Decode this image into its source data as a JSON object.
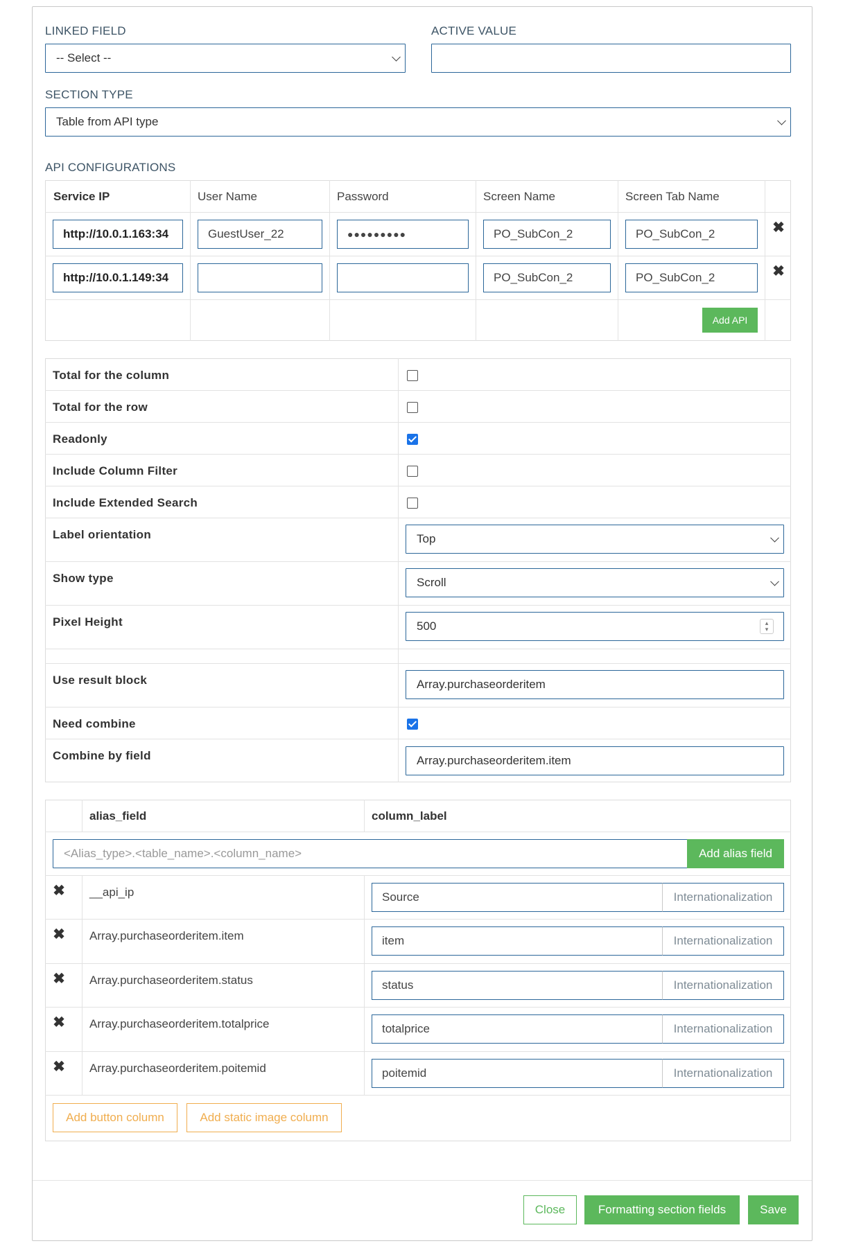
{
  "header": {
    "linked_field_label": "LINKED FIELD",
    "linked_field_value": "-- Select --",
    "active_value_label": "ACTIVE VALUE",
    "active_value_value": "",
    "section_type_label": "SECTION TYPE",
    "section_type_value": "Table from API type"
  },
  "api": {
    "title": "API CONFIGURATIONS",
    "columns": [
      "Service IP",
      "User Name",
      "Password",
      "Screen Name",
      "Screen Tab Name"
    ],
    "rows": [
      {
        "service_ip": "http://10.0.1.163:34",
        "user_name": "GuestUser_22",
        "password": "●●●●●●●●●",
        "screen_name": "PO_SubCon_2",
        "screen_tab_name": "PO_SubCon_2"
      },
      {
        "service_ip": "http://10.0.1.149:34",
        "user_name": "",
        "password": "",
        "screen_name": "PO_SubCon_2",
        "screen_tab_name": "PO_SubCon_2"
      }
    ],
    "remove_icon": "times-icon",
    "add_api_label": "Add API"
  },
  "props": {
    "total_column_label": "Total for the column",
    "total_column_checked": false,
    "total_row_label": "Total for the row",
    "total_row_checked": false,
    "readonly_label": "Readonly",
    "readonly_checked": true,
    "column_filter_label": "Include Column Filter",
    "column_filter_checked": false,
    "extended_search_label": "Include Extended Search",
    "extended_search_checked": false,
    "label_orientation_label": "Label orientation",
    "label_orientation_value": "Top",
    "show_type_label": "Show type",
    "show_type_value": "Scroll",
    "pixel_height_label": "Pixel Height",
    "pixel_height_value": "500",
    "use_result_block_label": "Use result block",
    "use_result_block_value": "Array.purchaseorderitem",
    "need_combine_label": "Need combine",
    "need_combine_checked": true,
    "combine_by_field_label": "Combine by field",
    "combine_by_field_value": "Array.purchaseorderitem.item"
  },
  "alias": {
    "col_alias_field": "alias_field",
    "col_column_label": "column_label",
    "input_placeholder": "<Alias_type>.<table_name>.<column_name>",
    "add_alias_label": "Add alias field",
    "intl_label": "Internationalization",
    "rows": [
      {
        "field": "__api_ip",
        "label": "Source"
      },
      {
        "field": "Array.purchaseorderitem.item",
        "label": "item"
      },
      {
        "field": "Array.purchaseorderitem.status",
        "label": "status"
      },
      {
        "field": "Array.purchaseorderitem.totalprice",
        "label": "totalprice"
      },
      {
        "field": "Array.purchaseorderitem.poitemid",
        "label": "poitemid"
      }
    ],
    "add_button_column_label": "Add button column",
    "add_static_image_label": "Add static image column"
  },
  "footer": {
    "close_label": "Close",
    "formatting_label": "Formatting section fields",
    "save_label": "Save"
  },
  "colors": {
    "accent_blue": "#2b6699",
    "green": "#5cb85c",
    "orange": "#f0ad4e",
    "check_blue": "#1a73e8"
  }
}
